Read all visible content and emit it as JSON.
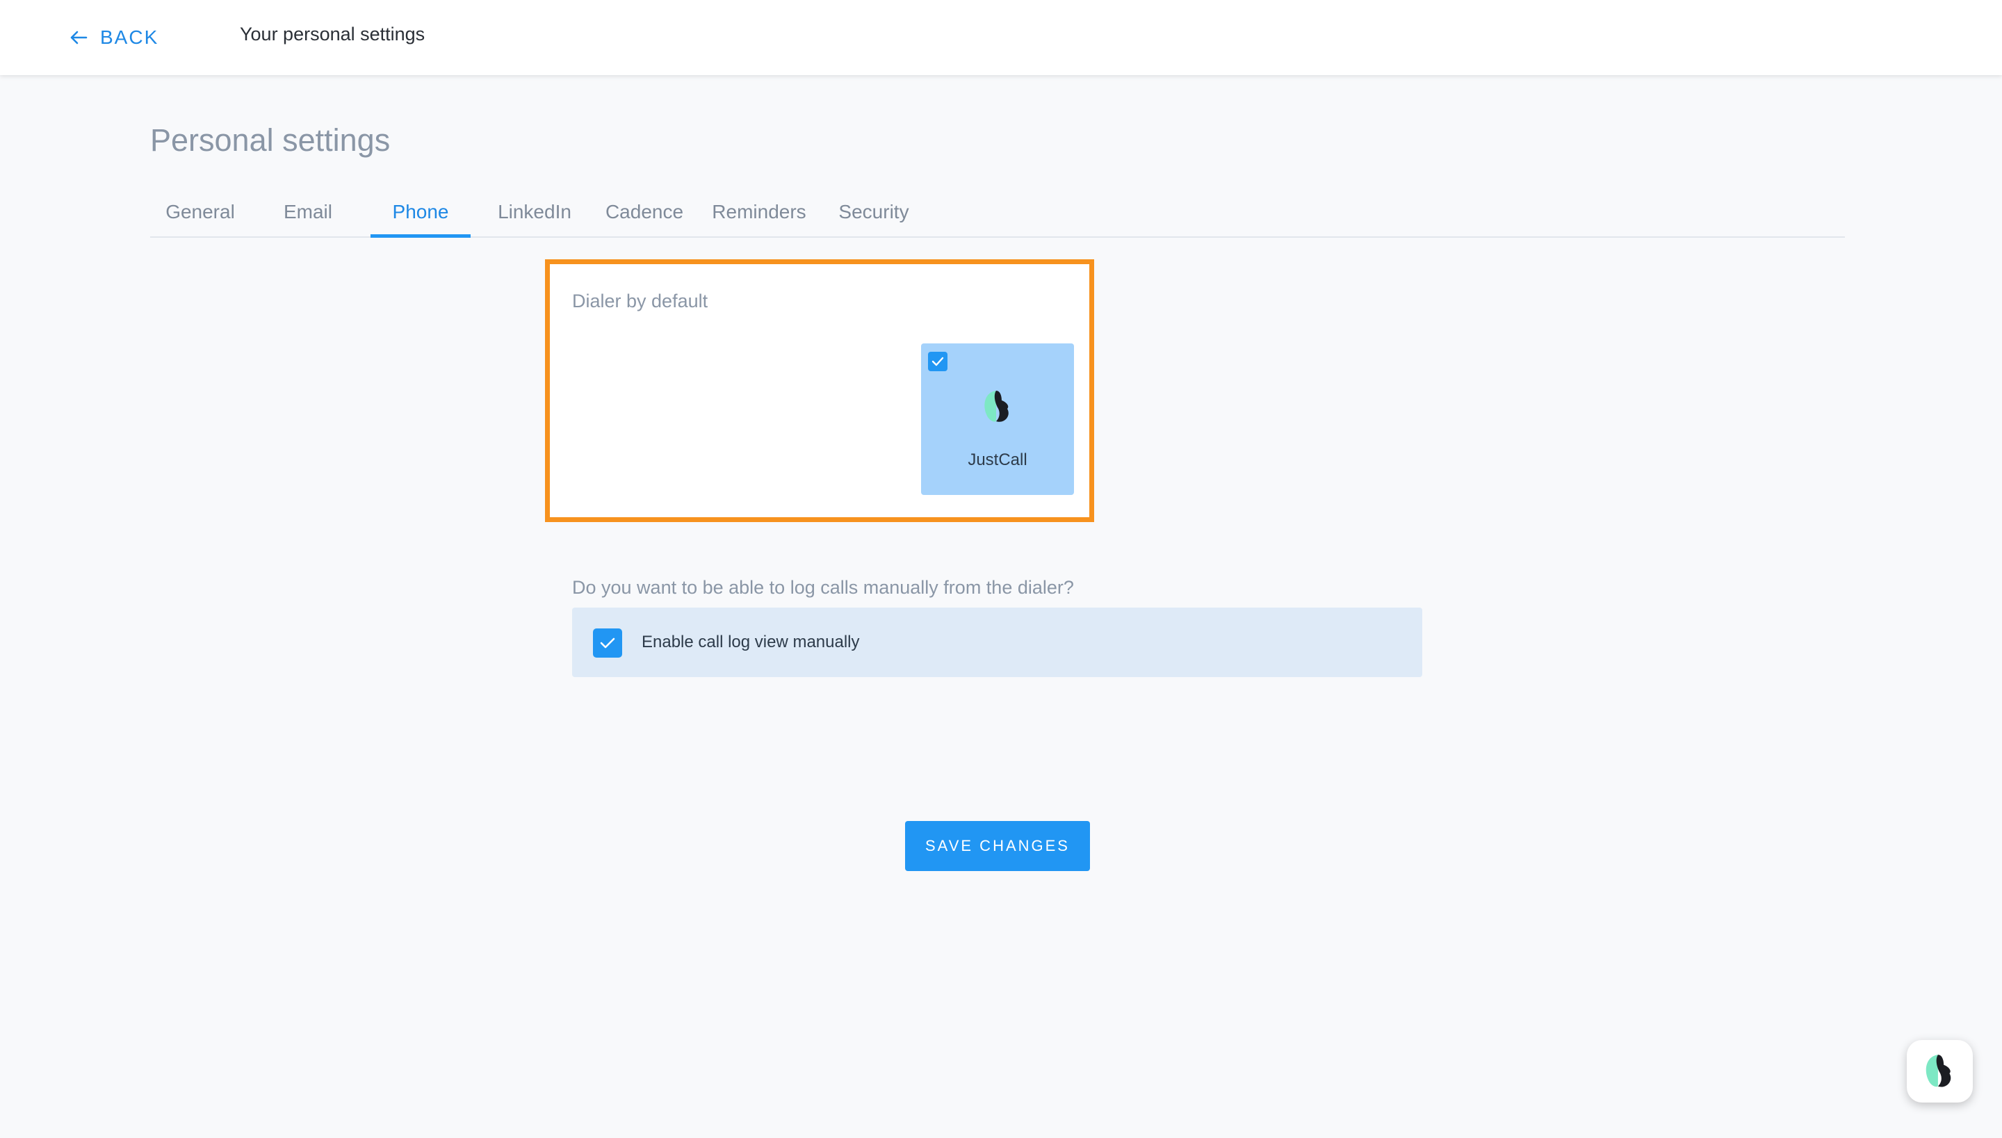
{
  "topbar": {
    "back_label": "BACK",
    "title": "Your personal settings"
  },
  "page": {
    "heading": "Personal settings"
  },
  "tabs": [
    {
      "label": "General",
      "active": false
    },
    {
      "label": "Email",
      "active": false
    },
    {
      "label": "Phone",
      "active": true
    },
    {
      "label": "LinkedIn",
      "active": false
    },
    {
      "label": "Cadence",
      "active": false
    },
    {
      "label": "Reminders",
      "active": false
    },
    {
      "label": "Security",
      "active": false
    }
  ],
  "dialer": {
    "label": "Dialer by default",
    "options": [
      {
        "name": "JustCall",
        "selected": true,
        "icon": "justcall-logo-icon"
      }
    ]
  },
  "call_log": {
    "question": "Do you want to be able to log calls manually from the dialer?",
    "option_label": "Enable call log view manually",
    "checked": true
  },
  "actions": {
    "save_label": "SAVE CHANGES"
  },
  "widget": {
    "icon": "justcall-logo-icon"
  },
  "colors": {
    "accent": "#2196f3",
    "highlight": "#f7921e",
    "selected_card": "#a5d2fb",
    "option_row": "#deeaf7"
  }
}
